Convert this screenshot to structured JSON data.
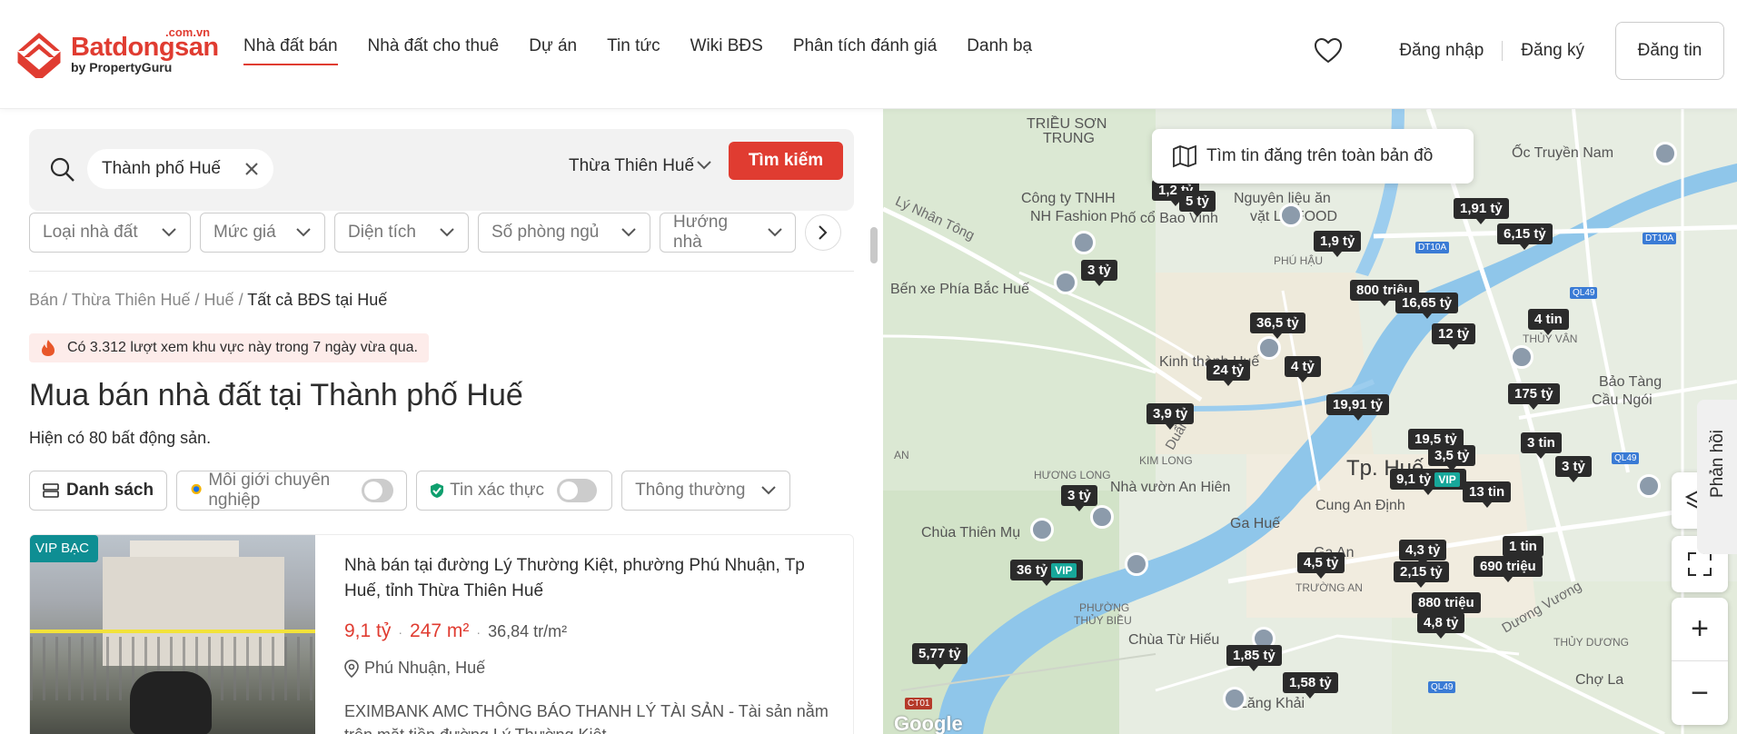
{
  "header": {
    "logo": {
      "brand": "Batdongsan",
      "tld": ".com.vn",
      "by": "by PropertyGuru"
    },
    "nav": [
      {
        "label": "Nhà đất bán",
        "active": true
      },
      {
        "label": "Nhà đất cho thuê"
      },
      {
        "label": "Dự án"
      },
      {
        "label": "Tin tức"
      },
      {
        "label": "Wiki BĐS"
      },
      {
        "label": "Phân tích đánh giá"
      },
      {
        "label": "Danh bạ"
      }
    ],
    "login": "Đăng nhập",
    "register": "Đăng ký",
    "post": "Đăng tin",
    "favorite_icon": "heart-icon"
  },
  "search": {
    "chip": "Thành phố Huế",
    "province": "Thừa Thiên Huế",
    "button": "Tìm kiếm"
  },
  "filters": [
    "Loại nhà đất",
    "Mức giá",
    "Diện tích",
    "Số phòng ngủ",
    "Hướng nhà"
  ],
  "breadcrumb": {
    "items": [
      "Bán",
      "Thừa Thiên Huế",
      "Huế"
    ],
    "current": "Tất cả BĐS tại Huế"
  },
  "alert": "Có 3.312 lượt xem khu vực này trong 7 ngày vừa qua.",
  "title": "Mua bán nhà đất tại Thành phố Huế",
  "count": "Hiện có 80 bất động sản.",
  "toolbar": {
    "list": "Danh sách",
    "agent": "Môi giới chuyên nghiệp",
    "verified": "Tin xác thực",
    "sort": "Thông thường"
  },
  "listing": {
    "badge": "VIP BẠC",
    "title": "Nhà bán tại đường Lý Thường Kiệt, phường Phú Nhuận, Tp Huế, tỉnh Thừa Thiên Huế",
    "price": "9,1 tỷ",
    "area": "247 m²",
    "price_per_m2": "36,84 tr/m²",
    "location": "Phú Nhuận, Huế",
    "description": "EXIMBANK AMC THÔNG BÁO THANH LÝ TÀI SẢN - Tài sản nằm trên mặt tiền đường Lý Thường Kiệt..."
  },
  "map": {
    "top_button": "Tìm tin đăng trên toàn bản đồ",
    "feedback": "Phản hồi",
    "google": "Google",
    "labels": {
      "trieu_son": "TRIỀU SƠN",
      "trung": "TRUNG",
      "cong_ty": "Công ty TNHH",
      "nh_fashion": "NH Fashion",
      "ly_nhan_tong": "Lý Nhân Tông",
      "pho_co": "Phố cổ Bao Vinh",
      "nguyen_lieu": "Nguyên liệu ăn",
      "vat_lieu": "vặt LK FOOD",
      "phu_hau": "PHÚ HẬU",
      "oc_truyen": "Ốc Truyền Nam",
      "ben_xe": "Bến xe Phía Bắc Huế",
      "kinh_thanh": "Kinh thành Huế",
      "thuy_van": "THỦY VÂN",
      "bao_tang": "Bảo Tàng",
      "cau_ngoi": "Cầu Ngói",
      "kim_long": "KIM LONG",
      "huong_long": "HƯƠNG LONG",
      "an": "AN",
      "nha_vuon": "Nhà vườn An Hiên",
      "tp_hue": "Tp. Huế",
      "ga_hue": "Ga Huế",
      "cung_an_dinh": "Cung An Định",
      "chua_thien_mu": "Chùa Thiên Mụ",
      "ga_an": "Ga An",
      "phuong": "PHƯỜNG",
      "thuy_bieu": "THỦY BIỀU",
      "truong_an": "TRƯỜNG AN",
      "chua_tu_hieu": "Chùa Từ Hiếu",
      "lang_khanh": "Lăng Khải",
      "thuy_duong": "THỦY DƯƠNG",
      "cho_la": "Chợ La",
      "duong_vuong": "Dương Vương",
      "hyun": "Duẩn",
      "dt10a": "DT10A",
      "dt10a2": "DT10A",
      "ql49": "QL49",
      "ql49b": "QL49",
      "ql49c": "QL49",
      "ct01": "CT01"
    },
    "pins": [
      {
        "label": "1,2 tỷ"
      },
      {
        "label": "5 tỷ"
      },
      {
        "label": "1,91 tỷ"
      },
      {
        "label": "6,15 tỷ"
      },
      {
        "label": "1,9 tỷ"
      },
      {
        "label": "3 tỷ"
      },
      {
        "label": "800 triệu"
      },
      {
        "label": "16,65 tỷ"
      },
      {
        "label": "36,5 tỷ"
      },
      {
        "label": "12 tỷ"
      },
      {
        "label": "4 tin"
      },
      {
        "label": "24 tỷ"
      },
      {
        "label": "4 tỷ"
      },
      {
        "label": "175 tỷ"
      },
      {
        "label": "19,91 tỷ"
      },
      {
        "label": "3,9 tỷ"
      },
      {
        "label": "19,5 tỷ"
      },
      {
        "label": "3 tin"
      },
      {
        "label": "3,5 tỷ"
      },
      {
        "label": "3 tỷ"
      },
      {
        "label": "9,1 tỷ",
        "vip": "VIP"
      },
      {
        "label": "13 tin"
      },
      {
        "label": "3 tỷ"
      },
      {
        "label": "4,3 tỷ"
      },
      {
        "label": "1 tin"
      },
      {
        "label": "4,5 tỷ"
      },
      {
        "label": "2,15 tỷ"
      },
      {
        "label": "690 triệu"
      },
      {
        "label": "36 tỷ",
        "vip": "VIP"
      },
      {
        "label": "880 triệu"
      },
      {
        "label": "4,8 tỷ"
      },
      {
        "label": "5,77 tỷ"
      },
      {
        "label": "1,85 tỷ"
      },
      {
        "label": "1,58 tỷ"
      }
    ]
  },
  "colors": {
    "brand": "#e03c31",
    "vip": "#17a79a",
    "pin": "#2b2b2b"
  }
}
